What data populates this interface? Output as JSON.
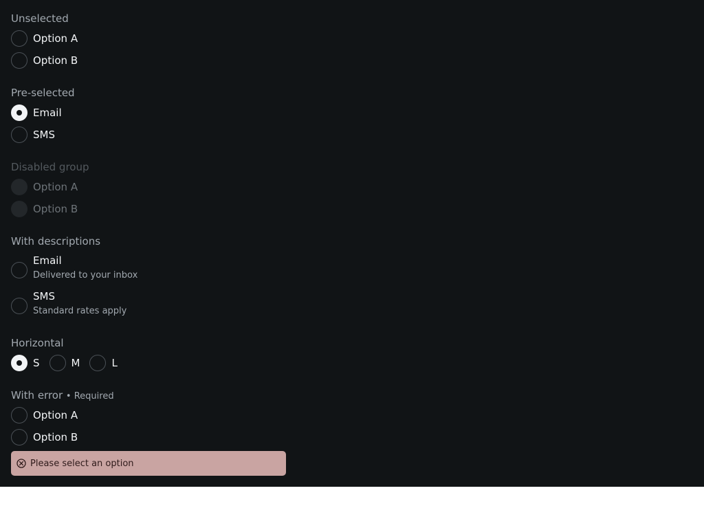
{
  "groups": {
    "unselected": {
      "label": "Unselected",
      "options": [
        "Option A",
        "Option B"
      ],
      "selected": null
    },
    "preselected": {
      "label": "Pre-selected",
      "options": [
        "Email",
        "SMS"
      ],
      "selected": "Email"
    },
    "disabled": {
      "label": "Disabled group",
      "options": [
        "Option A",
        "Option B"
      ],
      "selected": null
    },
    "descriptions": {
      "label": "With descriptions",
      "options": [
        {
          "title": "Email",
          "description": "Delivered to your inbox"
        },
        {
          "title": "SMS",
          "description": "Standard rates apply"
        }
      ],
      "selected": null
    },
    "horizontal": {
      "label": "Horizontal",
      "options": [
        "S",
        "M",
        "L"
      ],
      "selected": "S"
    },
    "error": {
      "label": "With error",
      "required": "• Required",
      "options": [
        "Option A",
        "Option B"
      ],
      "selected": null,
      "message": "Please select an option"
    }
  },
  "icons": {
    "error": "circle-x-icon"
  },
  "colors": {
    "background": "#111416",
    "text": "#f2f4f6",
    "muted": "#a2a9b0",
    "error_bg": "#c9a4a2"
  }
}
